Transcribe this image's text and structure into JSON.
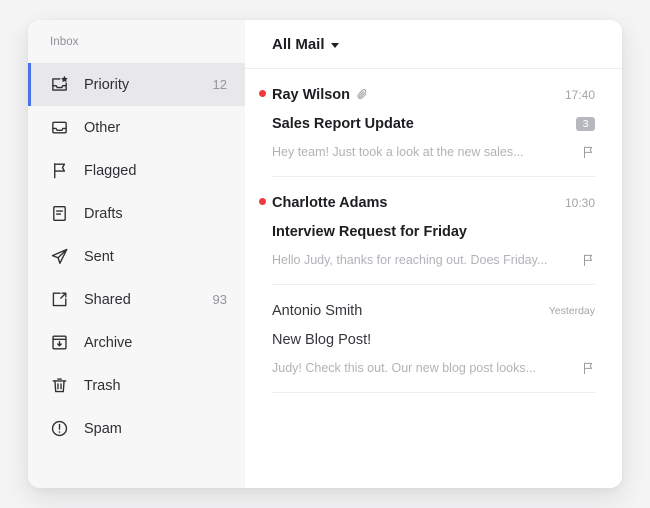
{
  "sidebar": {
    "title": "Inbox",
    "items": [
      {
        "label": "Priority",
        "count": "12",
        "icon": "inbox-star-icon",
        "active": true
      },
      {
        "label": "Other",
        "count": "",
        "icon": "inbox-icon",
        "active": false
      },
      {
        "label": "Flagged",
        "count": "",
        "icon": "flag-icon",
        "active": false
      },
      {
        "label": "Drafts",
        "count": "",
        "icon": "document-icon",
        "active": false
      },
      {
        "label": "Sent",
        "count": "",
        "icon": "paper-plane-icon",
        "active": false
      },
      {
        "label": "Shared",
        "count": "93",
        "icon": "share-icon",
        "active": false
      },
      {
        "label": "Archive",
        "count": "",
        "icon": "archive-icon",
        "active": false
      },
      {
        "label": "Trash",
        "count": "",
        "icon": "trash-icon",
        "active": false
      },
      {
        "label": "Spam",
        "count": "",
        "icon": "alert-circle-icon",
        "active": false
      }
    ]
  },
  "list": {
    "filter_label": "All Mail",
    "filter_caret_icon": "chevron-down-icon",
    "emails": [
      {
        "sender": "Ray Wilson",
        "subject": "Sales Report Update",
        "preview": "Hey team! Just took a look at the new sales...",
        "time": "17:40",
        "unread": true,
        "attachment": true,
        "thread_count": "3",
        "flag_icon": "flag-outline-icon"
      },
      {
        "sender": "Charlotte Adams",
        "subject": "Interview Request for Friday",
        "preview": "Hello Judy, thanks for reaching out. Does Friday...",
        "time": "10:30",
        "unread": true,
        "attachment": false,
        "thread_count": "",
        "flag_icon": "flag-outline-icon"
      },
      {
        "sender": "Antonio Smith",
        "subject": "New Blog Post!",
        "preview": "Judy! Check this out. Our new blog post looks...",
        "time": "Yesterday",
        "unread": false,
        "attachment": false,
        "thread_count": "",
        "flag_icon": "flag-outline-icon"
      }
    ]
  },
  "colors": {
    "accent": "#4a72e8",
    "unread_dot": "#f0393a",
    "badge": "#b6b8bd",
    "sidebar_bg": "#f7f7f8",
    "active_row_bg": "#e8e8ea"
  }
}
